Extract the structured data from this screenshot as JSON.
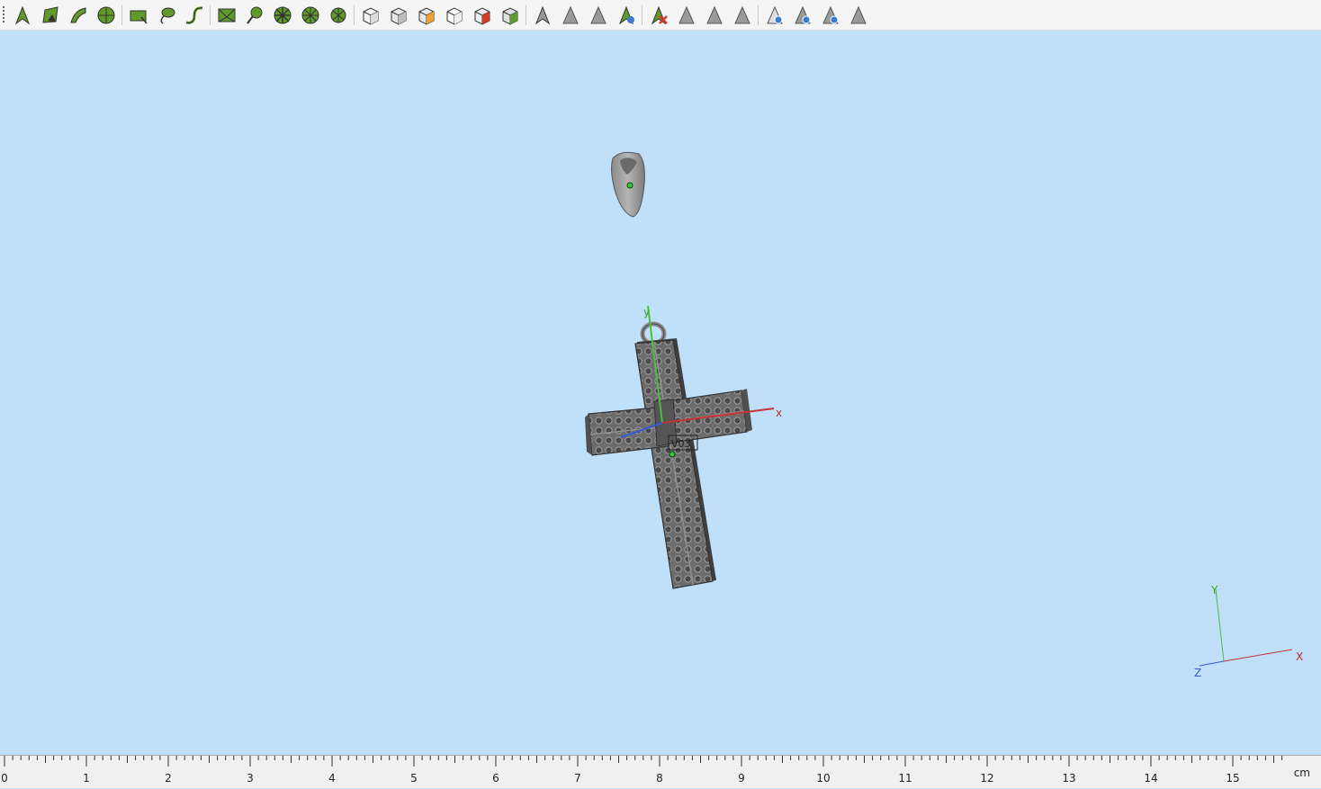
{
  "toolbar": {
    "groups": [
      [
        "select-arrow-icon",
        "select-face-icon",
        "select-curve-icon",
        "select-sphere-icon"
      ],
      [
        "rectangle-select-icon",
        "lasso-select-icon",
        "curve-path-icon"
      ],
      [
        "mesh-select-icon",
        "paint-select-icon",
        "snowflake-pattern-icon",
        "wheel-pattern-icon",
        "radial-pattern-icon"
      ],
      [
        "cube-view-icon",
        "cube-shaded-icon",
        "cube-color-icon",
        "cube-wire-icon",
        "cube-point-icon",
        "cube-grid-icon"
      ],
      [
        "arrow-gray-icon",
        "arrow-slash-icon",
        "arrow-move-icon",
        "arrow-lock-icon"
      ],
      [
        "arrow-delete-icon",
        "triangle-gray-icon",
        "triangle-copy-icon",
        "triangle-edit-icon"
      ],
      [
        "pyramid-eye-icon",
        "pyramid-refresh-icon",
        "pyramid-view-icon",
        "pyramid-edit-icon"
      ]
    ],
    "colors": {
      "green": "#5f9a2a",
      "gray": "#9a9a9a",
      "red": "#d23a2a",
      "blue": "#3a7ad0",
      "orange": "#f0a030"
    }
  },
  "viewport": {
    "background": "#bfe0f8",
    "model_label": "V03",
    "axis_labels": {
      "x": "x",
      "y": "y"
    },
    "corner_axes": {
      "x": "X",
      "y": "Y",
      "z": "Z"
    }
  },
  "ruler": {
    "labels": [
      "0",
      "1",
      "2",
      "3",
      "4",
      "5",
      "6",
      "7",
      "8",
      "9",
      "10",
      "11",
      "12",
      "13",
      "14",
      "15"
    ],
    "unit": "cm"
  }
}
